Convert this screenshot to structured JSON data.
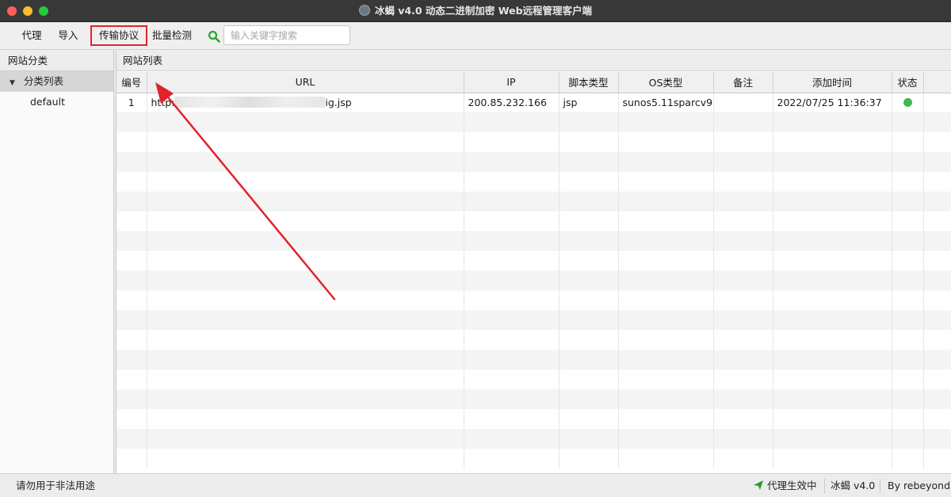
{
  "window": {
    "title": "冰蝎 v4.0 动态二进制加密 Web远程管理客户端"
  },
  "toolbar": {
    "proxy_label": "代理",
    "import_label": "导入",
    "protocol_label": "传输协议",
    "batch_check_label": "批量检测",
    "search_placeholder": "输入关键字搜索",
    "search_icon": "search-icon"
  },
  "left_panel": {
    "header": "网站分类",
    "tree_root": "分类列表",
    "tree_children": [
      "default"
    ]
  },
  "right_panel": {
    "header": "网站列表",
    "columns": [
      "编号",
      "URL",
      "IP",
      "脚本类型",
      "OS类型",
      "备注",
      "添加时间",
      "状态"
    ],
    "rows": [
      {
        "num": "1",
        "url_prefix": "http:",
        "url_suffix": "ig.jsp",
        "ip": "200.85.232.166",
        "script_type": "jsp",
        "os_type": "sunos5.11sparcv9",
        "remark": "",
        "added_time": "2022/07/25 11:36:37",
        "status_color": "#3fb950"
      }
    ]
  },
  "statusbar": {
    "left_text": "请勿用于非法用途",
    "proxy_status": "代理生效中",
    "version": "冰蝎 v4.0",
    "author": "By rebeyond"
  },
  "colors": {
    "highlight_box": "#e0242b",
    "annotation_arrow": "#e0242b",
    "status_ok": "#3fb950"
  }
}
